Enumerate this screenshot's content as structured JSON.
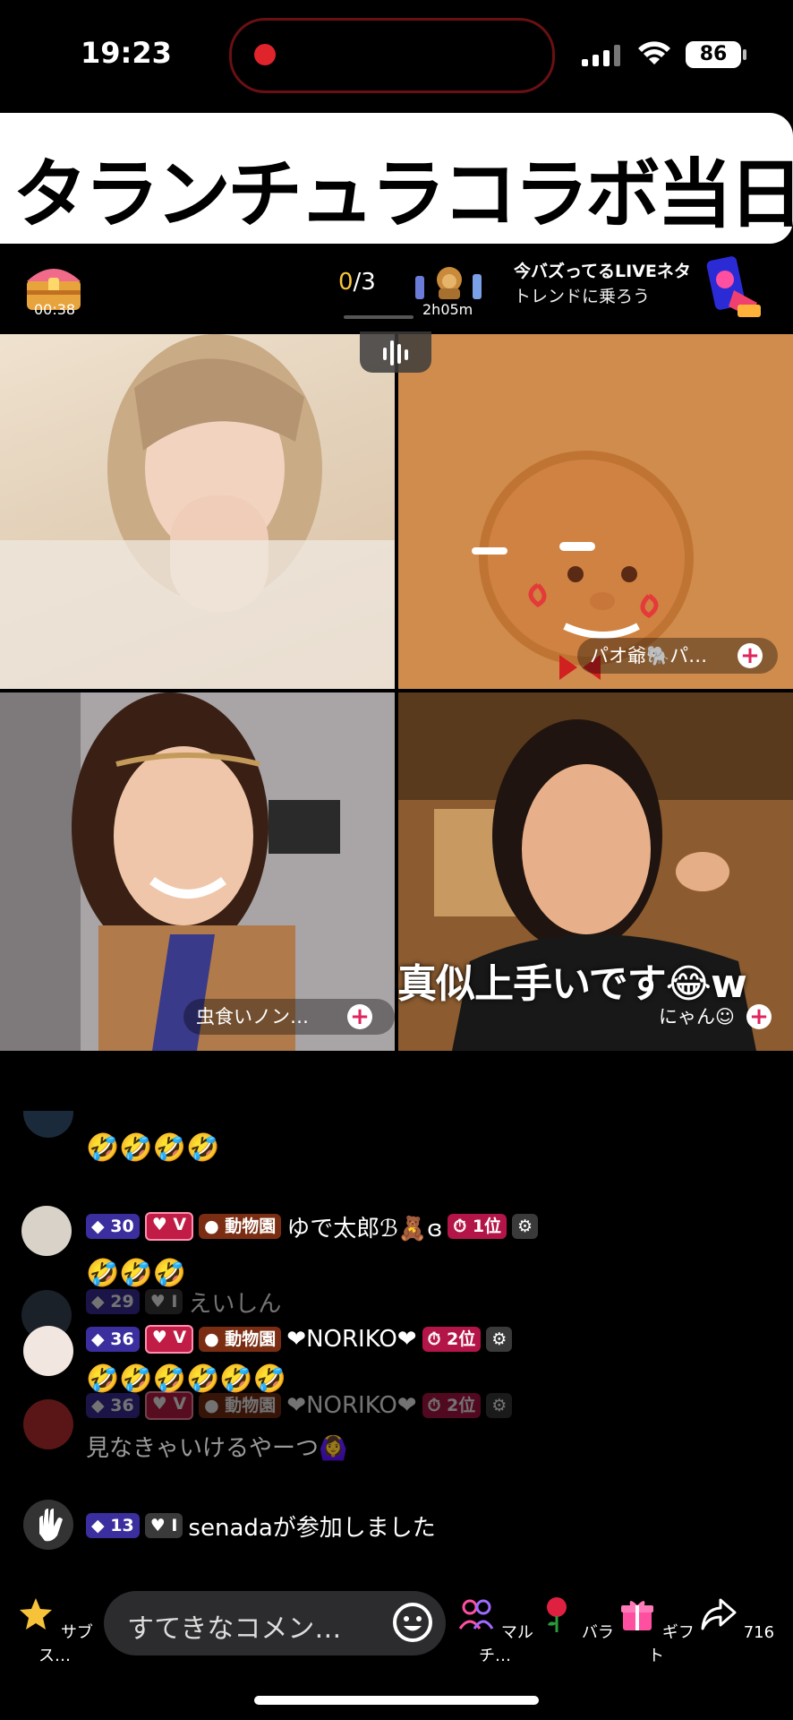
{
  "status": {
    "time": "19:23",
    "battery": "86"
  },
  "banner": {
    "title": "タランチュラコラボ当日"
  },
  "topbar": {
    "chest_timer": "00:38",
    "goal_current": "0",
    "goal_total": "/3",
    "animals_timer": "2h05m",
    "trend_title": "今バズってるLIVEネタ",
    "trend_sub": "トレンドに乗ろう"
  },
  "tiles": [
    {
      "name": ""
    },
    {
      "name": "パオ爺🐘パ…"
    },
    {
      "name": "虫食いノン…"
    },
    {
      "name": "にゃん☺︎"
    }
  ],
  "caption": "真似上手いです😂w",
  "chat": [
    {
      "emojis": "🤣🤣🤣🤣"
    },
    {
      "level": "30",
      "v": "V",
      "zoo": "動物園",
      "user": "ゆで太郎ℬ🧸ɞ",
      "rank": "1位"
    },
    {
      "emojis": "🤣🤣🤣",
      "faded_level": "29",
      "faded_user": "えいしん"
    },
    {
      "level": "36",
      "v": "V",
      "zoo": "動物園",
      "user": "❤NORIKO❤",
      "rank": "2位"
    },
    {
      "emojis": "🤣🤣🤣🤣🤣🤣"
    },
    {
      "faded_level": "36",
      "faded_v": "V",
      "faded_zoo": "動物園",
      "faded_user": "❤NORIKO❤",
      "faded_rank": "2位"
    },
    {
      "message": "見なきゃいけるやーつ🙆‍♀️"
    },
    {
      "level": "13",
      "v": "I",
      "message": "senadaが参加しました"
    }
  ],
  "bottom": {
    "subscribe": "サブス…",
    "comment_placeholder": "すてきなコメン…",
    "multi": "マルチ…",
    "rose": "バラ",
    "gift": "ギフト",
    "share_count": "716"
  },
  "colors": {
    "accent": "#e0245e",
    "record": "#e0242c",
    "goal_yellow": "#f7c53c"
  }
}
